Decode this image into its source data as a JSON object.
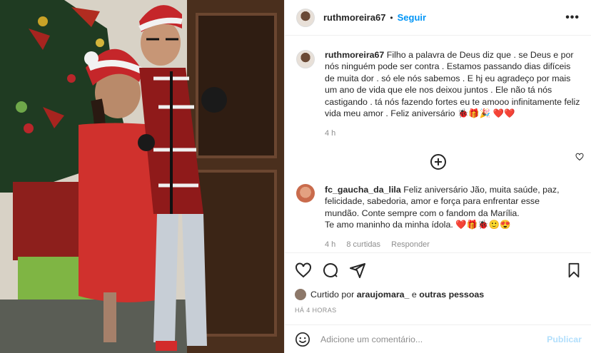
{
  "header": {
    "username": "ruthmoreira67",
    "separator": "•",
    "follow_label": "Seguir",
    "more_label": "•••"
  },
  "caption": {
    "username": "ruthmoreira67",
    "text": "Filho a palavra de Deus diz que . se Deus e por nós ninguém pode ser contra . Estamos passando dias difíceis de muita dor . só ele nós sabemos . E hj eu agradeço por mais um ano de vida que ele nos deixou juntos . Ele não tá nós castigando . tá nós fazendo fortes eu te amooo infinitamente feliz vida meu amor . Feliz aniversário",
    "emojis": "🐞🎁🎉 ❤️❤️",
    "time": "4 h"
  },
  "comment": {
    "username": "fc_gaucha_da_lila",
    "text": "Feliz aniversário Jão, muita saúde, paz, felicidade, sabedoria, amor e força para enfrentar esse mundão. Conte sempre com o fandom da Marília.",
    "text2": "Te amo maninho da minha ídola.",
    "emojis": "❤️🎁🐞🙂😍",
    "time": "4 h",
    "likes": "8 curtidas",
    "reply": "Responder"
  },
  "likes": {
    "prefix": "Curtido por",
    "user": "araujomara_",
    "conj": "e",
    "others": "outras pessoas"
  },
  "time_ago": "HÁ 4 HORAS",
  "add_comment": {
    "placeholder": "Adicione um comentário...",
    "publish": "Publicar"
  },
  "icons": {
    "more": "more-icon",
    "load_more": "plus-circle-icon",
    "like": "heart-icon",
    "comment": "comment-icon",
    "share": "share-icon",
    "save": "bookmark-icon",
    "emoji": "emoji-icon"
  },
  "colors": {
    "accent": "#0095f6",
    "publish_disabled": "#b2dffc",
    "muted": "#8e8e8e"
  }
}
